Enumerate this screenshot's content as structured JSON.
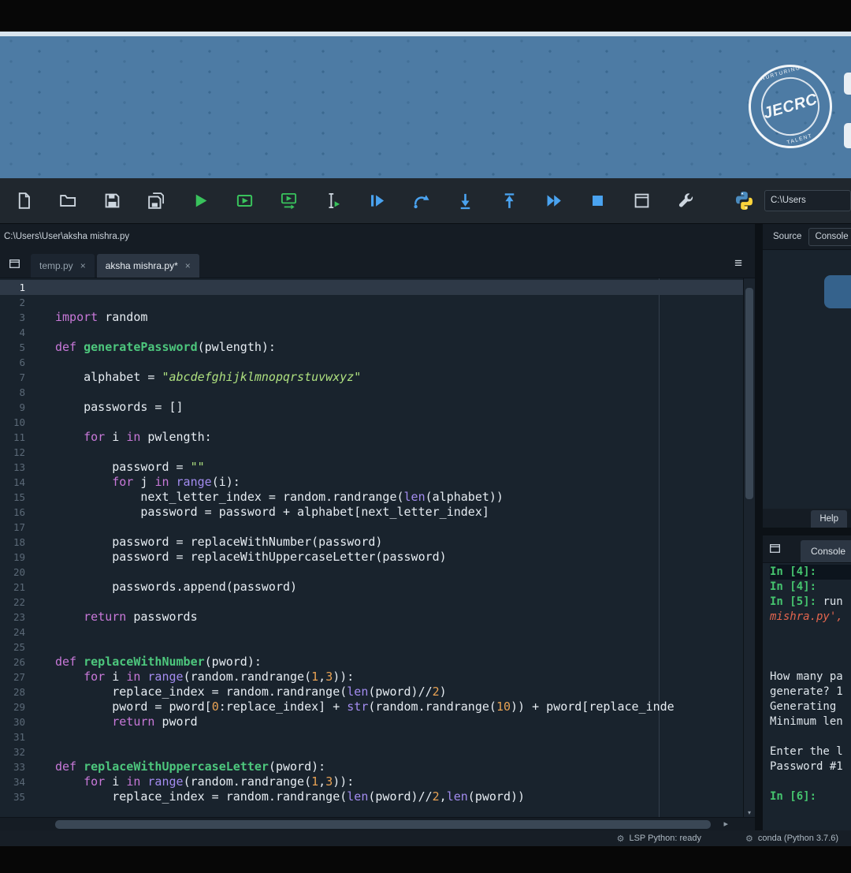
{
  "banner": {
    "stamp": {
      "top": "NURTURING",
      "main": "JECRC",
      "bottom": "TALENT"
    }
  },
  "toolbar": {
    "buttons": [
      "new-file",
      "open-file",
      "save-file",
      "save-all",
      "run-file",
      "run-cell",
      "run-cell-advance",
      "run-selection",
      "debug-file",
      "step-over",
      "step-into",
      "step-out",
      "continue-execution",
      "stop-debug",
      "maximize-pane",
      "tools"
    ],
    "cwd": "C:\\Users"
  },
  "editor": {
    "file_path": "C:\\Users\\User\\aksha mishra.py",
    "tabs": [
      {
        "label": "temp.py",
        "close": "×",
        "active": false
      },
      {
        "label": "aksha mishra.py*",
        "close": "×",
        "active": true
      }
    ],
    "options_icon": "≡",
    "code": [
      [],
      [],
      [
        [
          "kw",
          "import"
        ],
        [
          "txt",
          " random"
        ]
      ],
      [],
      [
        [
          "kw",
          "def"
        ],
        [
          "txt",
          " "
        ],
        [
          "defn",
          "generatePassword"
        ],
        [
          "txt",
          "(pwlength):"
        ]
      ],
      [],
      [
        [
          "txt",
          "    alphabet = "
        ],
        [
          "str",
          "\"abcdefghijklmnopqrstuvwxyz\""
        ]
      ],
      [],
      [
        [
          "txt",
          "    passwords = []"
        ]
      ],
      [],
      [
        [
          "txt",
          "    "
        ],
        [
          "kw",
          "for"
        ],
        [
          "txt",
          " i "
        ],
        [
          "kw",
          "in"
        ],
        [
          "txt",
          " pwlength:"
        ]
      ],
      [],
      [
        [
          "txt",
          "        password = "
        ],
        [
          "str",
          "\"\""
        ]
      ],
      [
        [
          "txt",
          "        "
        ],
        [
          "kw",
          "for"
        ],
        [
          "txt",
          " j "
        ],
        [
          "kw",
          "in"
        ],
        [
          "txt",
          " "
        ],
        [
          "bi",
          "range"
        ],
        [
          "txt",
          "(i):"
        ]
      ],
      [
        [
          "txt",
          "            next_letter_index = random.randrange("
        ],
        [
          "bi",
          "len"
        ],
        [
          "txt",
          "(alphabet))"
        ]
      ],
      [
        [
          "txt",
          "            password = password + alphabet[next_letter_index]"
        ]
      ],
      [],
      [
        [
          "txt",
          "        password = replaceWithNumber(password)"
        ]
      ],
      [
        [
          "txt",
          "        password = replaceWithUppercaseLetter(password)"
        ]
      ],
      [],
      [
        [
          "txt",
          "        passwords.append(password)"
        ]
      ],
      [],
      [
        [
          "txt",
          "    "
        ],
        [
          "kw",
          "return"
        ],
        [
          "txt",
          " passwords"
        ]
      ],
      [],
      [],
      [
        [
          "kw",
          "def"
        ],
        [
          "txt",
          " "
        ],
        [
          "defn",
          "replaceWithNumber"
        ],
        [
          "txt",
          "(pword):"
        ]
      ],
      [
        [
          "txt",
          "    "
        ],
        [
          "kw",
          "for"
        ],
        [
          "txt",
          " i "
        ],
        [
          "kw",
          "in"
        ],
        [
          "txt",
          " "
        ],
        [
          "bi",
          "range"
        ],
        [
          "txt",
          "(random.randrange("
        ],
        [
          "num",
          "1"
        ],
        [
          "txt",
          ","
        ],
        [
          "num",
          "3"
        ],
        [
          "txt",
          ")):"
        ]
      ],
      [
        [
          "txt",
          "        replace_index = random.randrange("
        ],
        [
          "bi",
          "len"
        ],
        [
          "txt",
          "(pword)//"
        ],
        [
          "num",
          "2"
        ],
        [
          "txt",
          ")"
        ]
      ],
      [
        [
          "txt",
          "        pword = pword["
        ],
        [
          "num",
          "0"
        ],
        [
          "txt",
          ":replace_index] + "
        ],
        [
          "bi",
          "str"
        ],
        [
          "txt",
          "(random.randrange("
        ],
        [
          "num",
          "10"
        ],
        [
          "txt",
          ")) + pword[replace_inde"
        ]
      ],
      [
        [
          "txt",
          "        "
        ],
        [
          "kw",
          "return"
        ],
        [
          "txt",
          " pword"
        ]
      ],
      [],
      [],
      [
        [
          "kw",
          "def"
        ],
        [
          "txt",
          " "
        ],
        [
          "defn",
          "replaceWithUppercaseLetter"
        ],
        [
          "txt",
          "(pword):"
        ]
      ],
      [
        [
          "txt",
          "    "
        ],
        [
          "kw",
          "for"
        ],
        [
          "txt",
          " i "
        ],
        [
          "kw",
          "in"
        ],
        [
          "txt",
          " "
        ],
        [
          "bi",
          "range"
        ],
        [
          "txt",
          "(random.randrange("
        ],
        [
          "num",
          "1"
        ],
        [
          "txt",
          ","
        ],
        [
          "num",
          "3"
        ],
        [
          "txt",
          ")):"
        ]
      ],
      [
        [
          "txt",
          "        replace_index = random.randrange("
        ],
        [
          "bi",
          "len"
        ],
        [
          "txt",
          "(pword)//"
        ],
        [
          "num",
          "2"
        ],
        [
          "txt",
          ","
        ],
        [
          "bi",
          "len"
        ],
        [
          "txt",
          "(pword))"
        ]
      ]
    ]
  },
  "help_pane": {
    "source_label": "Source",
    "source_value": "Console",
    "bottom_tab": "Help"
  },
  "console_pane": {
    "tab_label": "Console",
    "lines": [
      {
        "cls": "sel",
        "prompt": "In [4]:",
        "text": ""
      },
      {
        "prompt": "In [4]:",
        "text": ""
      },
      {
        "prompt": "In [5]:",
        "text": "run"
      },
      {
        "cls": "em",
        "text": "mishra.py',"
      },
      {
        "text": ""
      },
      {
        "text": ""
      },
      {
        "text": ""
      },
      {
        "text": "How many pa"
      },
      {
        "text": "generate? 1"
      },
      {
        "text": "Generating"
      },
      {
        "text": "Minimum len"
      },
      {
        "text": ""
      },
      {
        "text": "Enter the l"
      },
      {
        "text": "Password #1"
      },
      {
        "text": ""
      },
      {
        "prompt": "In [6]:",
        "text": ""
      }
    ]
  },
  "statusbar": {
    "items": [
      {
        "icon": "gear",
        "text": "LSP Python: ready"
      },
      {
        "icon": "gear",
        "text": "conda (Python 3.7.6)"
      }
    ]
  }
}
